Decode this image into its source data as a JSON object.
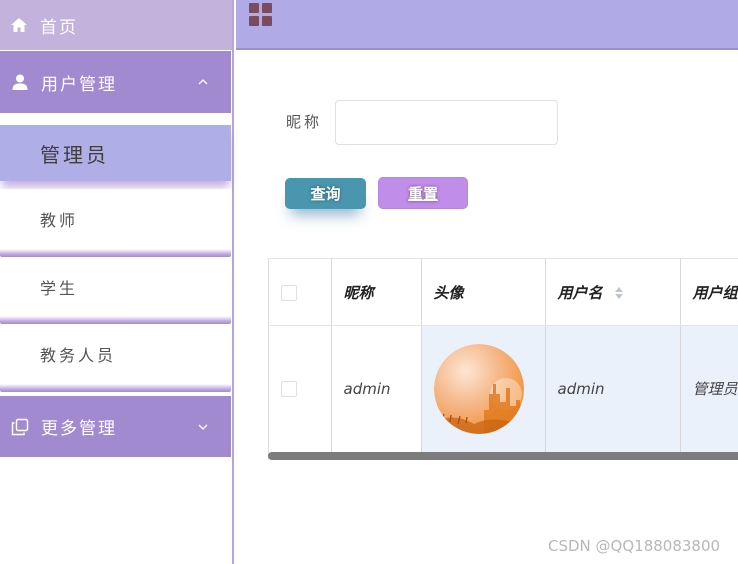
{
  "sidebar": {
    "home": {
      "label": "首页",
      "icon": "home-icon"
    },
    "user_mgmt": {
      "label": "用户管理",
      "icon": "user-icon",
      "expanded": true,
      "items": [
        {
          "label": "管理员",
          "active": true
        },
        {
          "label": "教师",
          "active": false
        },
        {
          "label": "学生",
          "active": false
        },
        {
          "label": "教务人员",
          "active": false
        }
      ]
    },
    "more_mgmt": {
      "label": "更多管理",
      "icon": "copy-icon",
      "expanded": false
    }
  },
  "topbar": {
    "icon": "grid-menu-icon"
  },
  "search": {
    "nickname_label": "昵称",
    "nickname_value": "",
    "nickname_placeholder": "",
    "search_button": "查询",
    "reset_button": "重置"
  },
  "table": {
    "headers": [
      "昵称",
      "头像",
      "用户名",
      "用户组"
    ],
    "sortable_column": "用户名",
    "rows": [
      {
        "nickname": "admin",
        "avatar": "avatar-image",
        "username": "admin",
        "group": "管理员"
      }
    ]
  },
  "watermark": "CSDN @QQ188083800",
  "colors": {
    "sidebar_group": "#a28ad0",
    "sidebar_home": "#c2b2dc",
    "sidebar_active": "#b0aee6",
    "topbar": "#b0aae6",
    "search_button": "#4a96ae",
    "reset_button": "#c08de8",
    "row_highlight": "#ebf1fa"
  }
}
